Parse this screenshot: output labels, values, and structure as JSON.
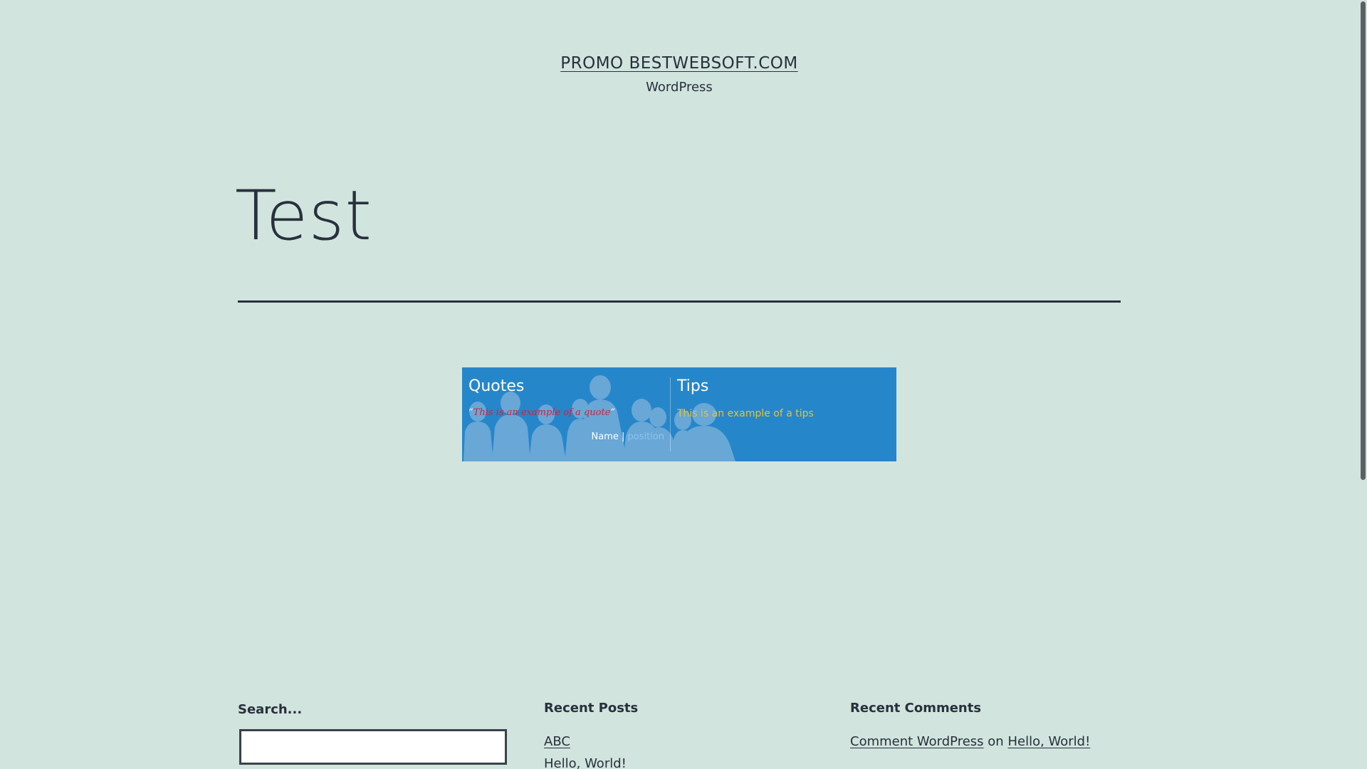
{
  "header": {
    "site_title": "PROMO BESTWEBSOFT.COM",
    "site_description": "WordPress"
  },
  "entry": {
    "title": "Test"
  },
  "widget": {
    "quotes": {
      "heading": "Quotes",
      "open_mark": "“",
      "quote": "This is an example of a quote",
      "close_mark": "”",
      "author_name": "Name",
      "separator": " | ",
      "author_position": "position"
    },
    "tips": {
      "heading": "Tips",
      "text": "This is an example of a tips"
    }
  },
  "footer": {
    "search": {
      "label": "Search...",
      "value": ""
    },
    "recent_posts": {
      "heading": "Recent Posts",
      "items": [
        "ABC",
        "Hello, World!"
      ]
    },
    "recent_comments": {
      "heading": "Recent Comments",
      "author": "Comment WordPress",
      "connector": "on",
      "post": "Hello, World!"
    }
  },
  "colors": {
    "background": "#d1e4dd",
    "text": "#28303d",
    "widget_background": "#2686ca",
    "quote_text": "#d2203b",
    "tips_text": "#e6c23a"
  }
}
